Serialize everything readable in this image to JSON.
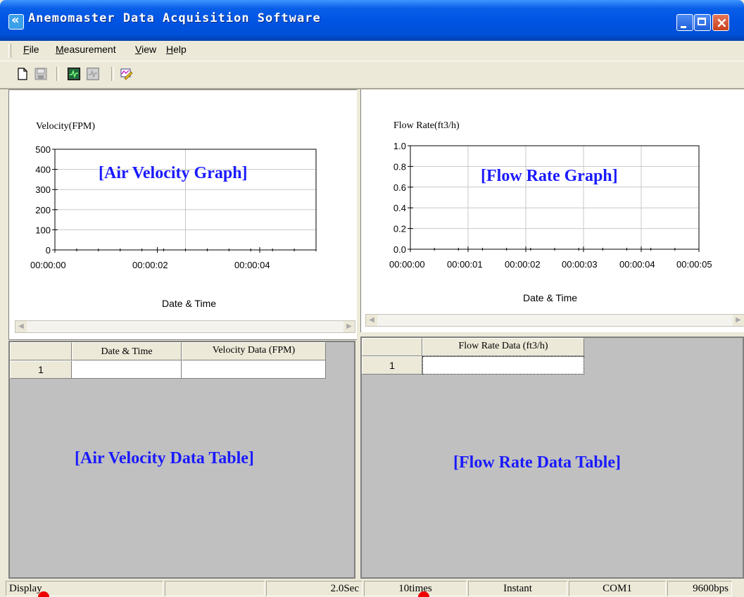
{
  "window": {
    "title": "Anemomaster Data Acquisition Software"
  },
  "menu": [
    {
      "pre": "",
      "u": "F",
      "post": "ile"
    },
    {
      "pre": "",
      "u": "M",
      "post": "easurement"
    },
    {
      "pre": "",
      "u": "V",
      "post": "iew"
    },
    {
      "pre": "",
      "u": "H",
      "post": "elp"
    }
  ],
  "toolbar_icons": [
    "new-file-icon",
    "save-icon",
    "start-measurement-icon",
    "stop-measurement-icon",
    "settings-chart-icon"
  ],
  "velocity_panel": {
    "overlay": "[Air Velocity Graph]",
    "table_overlay": "[Air Velocity Data Table]",
    "table": {
      "headers": [
        "",
        "Date & Time",
        "Velocity Data (FPM)"
      ],
      "rows": [
        [
          "1",
          "",
          ""
        ]
      ]
    }
  },
  "flow_panel": {
    "overlay": "[Flow Rate Graph]",
    "table_overlay": "[Flow Rate Data Table]",
    "table": {
      "headers": [
        "",
        "Flow Rate Data (ft3/h)"
      ],
      "rows": [
        [
          "1",
          ""
        ]
      ]
    }
  },
  "chart_data": [
    {
      "type": "line",
      "ylabel": "Velocity(FPM)",
      "xlabel": "Date & Time",
      "ylim": [
        0,
        500
      ],
      "yticks": [
        "500",
        "400",
        "300",
        "200",
        "100",
        "0"
      ],
      "xticks": [
        "00:00:00",
        "00:00:02",
        "00:00:04"
      ],
      "grid": true,
      "series": []
    },
    {
      "type": "line",
      "ylabel": "Flow Rate(ft3/h)",
      "xlabel": "Date & Time",
      "ylim": [
        0.0,
        1.0
      ],
      "yticks": [
        "1.0",
        "0.8",
        "0.6",
        "0.4",
        "0.2",
        "0.0"
      ],
      "xticks": [
        "00:00:00",
        "00:00:01",
        "00:00:02",
        "00:00:03",
        "00:00:04",
        "00:00:05"
      ],
      "grid": true,
      "series": []
    }
  ],
  "status": [
    "Display",
    "",
    "2.0Sec",
    "10times",
    "Instant",
    "COM1",
    "9600bps"
  ],
  "colors": {
    "title_bar": "#0054e3",
    "overlay_text": "#1a1aff",
    "grid_bg": "#c0c0c0",
    "marker": "#ee0000"
  }
}
